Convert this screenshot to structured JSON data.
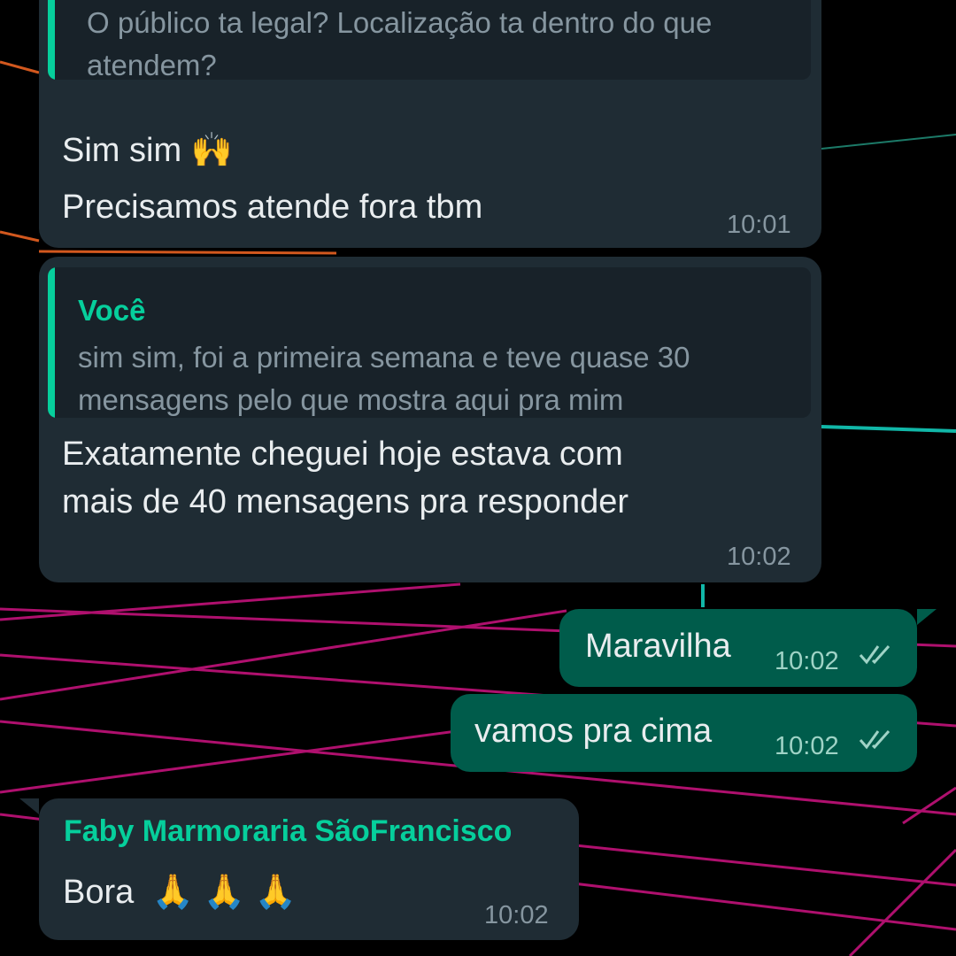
{
  "messages": [
    {
      "quote": {
        "text": "O público ta legal? Localização ta dentro do que atendem?"
      },
      "lines": [
        "Sim sim",
        "Precisamos atende fora tbm"
      ],
      "emoji": "🙌",
      "time": "10:01"
    },
    {
      "quote": {
        "author": "Você",
        "text": "sim sim, foi a primeira semana e teve quase 30 mensagens pelo que mostra aqui pra mim"
      },
      "lines": [
        "Exatamente cheguei hoje estava com",
        "mais de 40 mensagens pra responder"
      ],
      "time": "10:02"
    },
    {
      "outgoing": true,
      "text": "Maravilha",
      "time": "10:02",
      "status": "read"
    },
    {
      "outgoing": true,
      "text": "vamos pra cima",
      "time": "10:02",
      "status": "read"
    },
    {
      "sender": "Faby Marmoraria SãoFrancisco",
      "text": "Bora",
      "emoji": "🙏 🙏 🙏",
      "time": "10:02"
    }
  ],
  "colors": {
    "incoming_bubble": "#1f2c34",
    "outgoing_bubble": "#005c4b",
    "accent": "#06cf9c",
    "wallpaper_grid": "#c2127a"
  },
  "icons": {
    "read_receipt": "double-check-icon"
  }
}
